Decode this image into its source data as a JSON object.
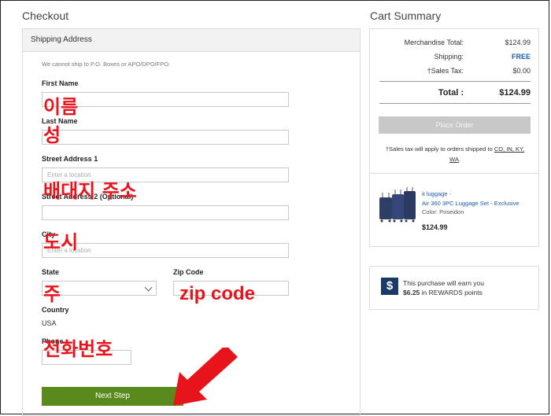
{
  "checkout": {
    "title": "Checkout",
    "shipping_header": "Shipping Address",
    "note": "We cannot ship to P.O. Boxes or APO/DPO/FPO.",
    "first_name_label": "First Name",
    "last_name_label": "Last Name",
    "street1_label": "Street Address 1",
    "street1_placeholder": "Enter a location",
    "street2_label": "Street Address 2 (Optional)",
    "city_label": "City",
    "city_placeholder": "Enter a location",
    "state_label": "State",
    "zip_label": "Zip Code",
    "country_label": "Country",
    "country_value": "USA",
    "phone_label": "Phone",
    "next_button": "Next Step"
  },
  "annotations": {
    "first_name": "이름",
    "last_name": "성",
    "street": "배대지 주소",
    "city": "도시",
    "state": "주",
    "zip": "zip code",
    "phone": "전화번호",
    "arrow_color": "#e8141c"
  },
  "cart": {
    "title": "Cart Summary",
    "merchandise_label": "Merchandise Total:",
    "merchandise_value": "$124.99",
    "shipping_label": "Shipping:",
    "shipping_value": "FREE",
    "tax_label": "†Sales Tax:",
    "tax_value": "$0.00",
    "total_label": "Total :",
    "total_value": "$124.99",
    "place_order": "Place Order",
    "tax_note_prefix": "†Sales tax will apply to orders shipped to",
    "tax_note_states": "CO, IN, KY, WA",
    "tax_note_suffix": ".",
    "item_brand": "it luggage -",
    "item_name": "Air 360 3PC Luggage Set - Exclusive",
    "item_color_label": "Color:",
    "item_color_value": "Poseidon",
    "item_price": "$124.99"
  },
  "reward": {
    "icon": "$",
    "line1": "This purchase will earn you",
    "amount": "$6.25",
    "line2_suffix": "in REWARDS points"
  },
  "colors": {
    "next_button": "#5a8a1e",
    "link": "#1a5cb0",
    "annotation": "#e8141c"
  }
}
